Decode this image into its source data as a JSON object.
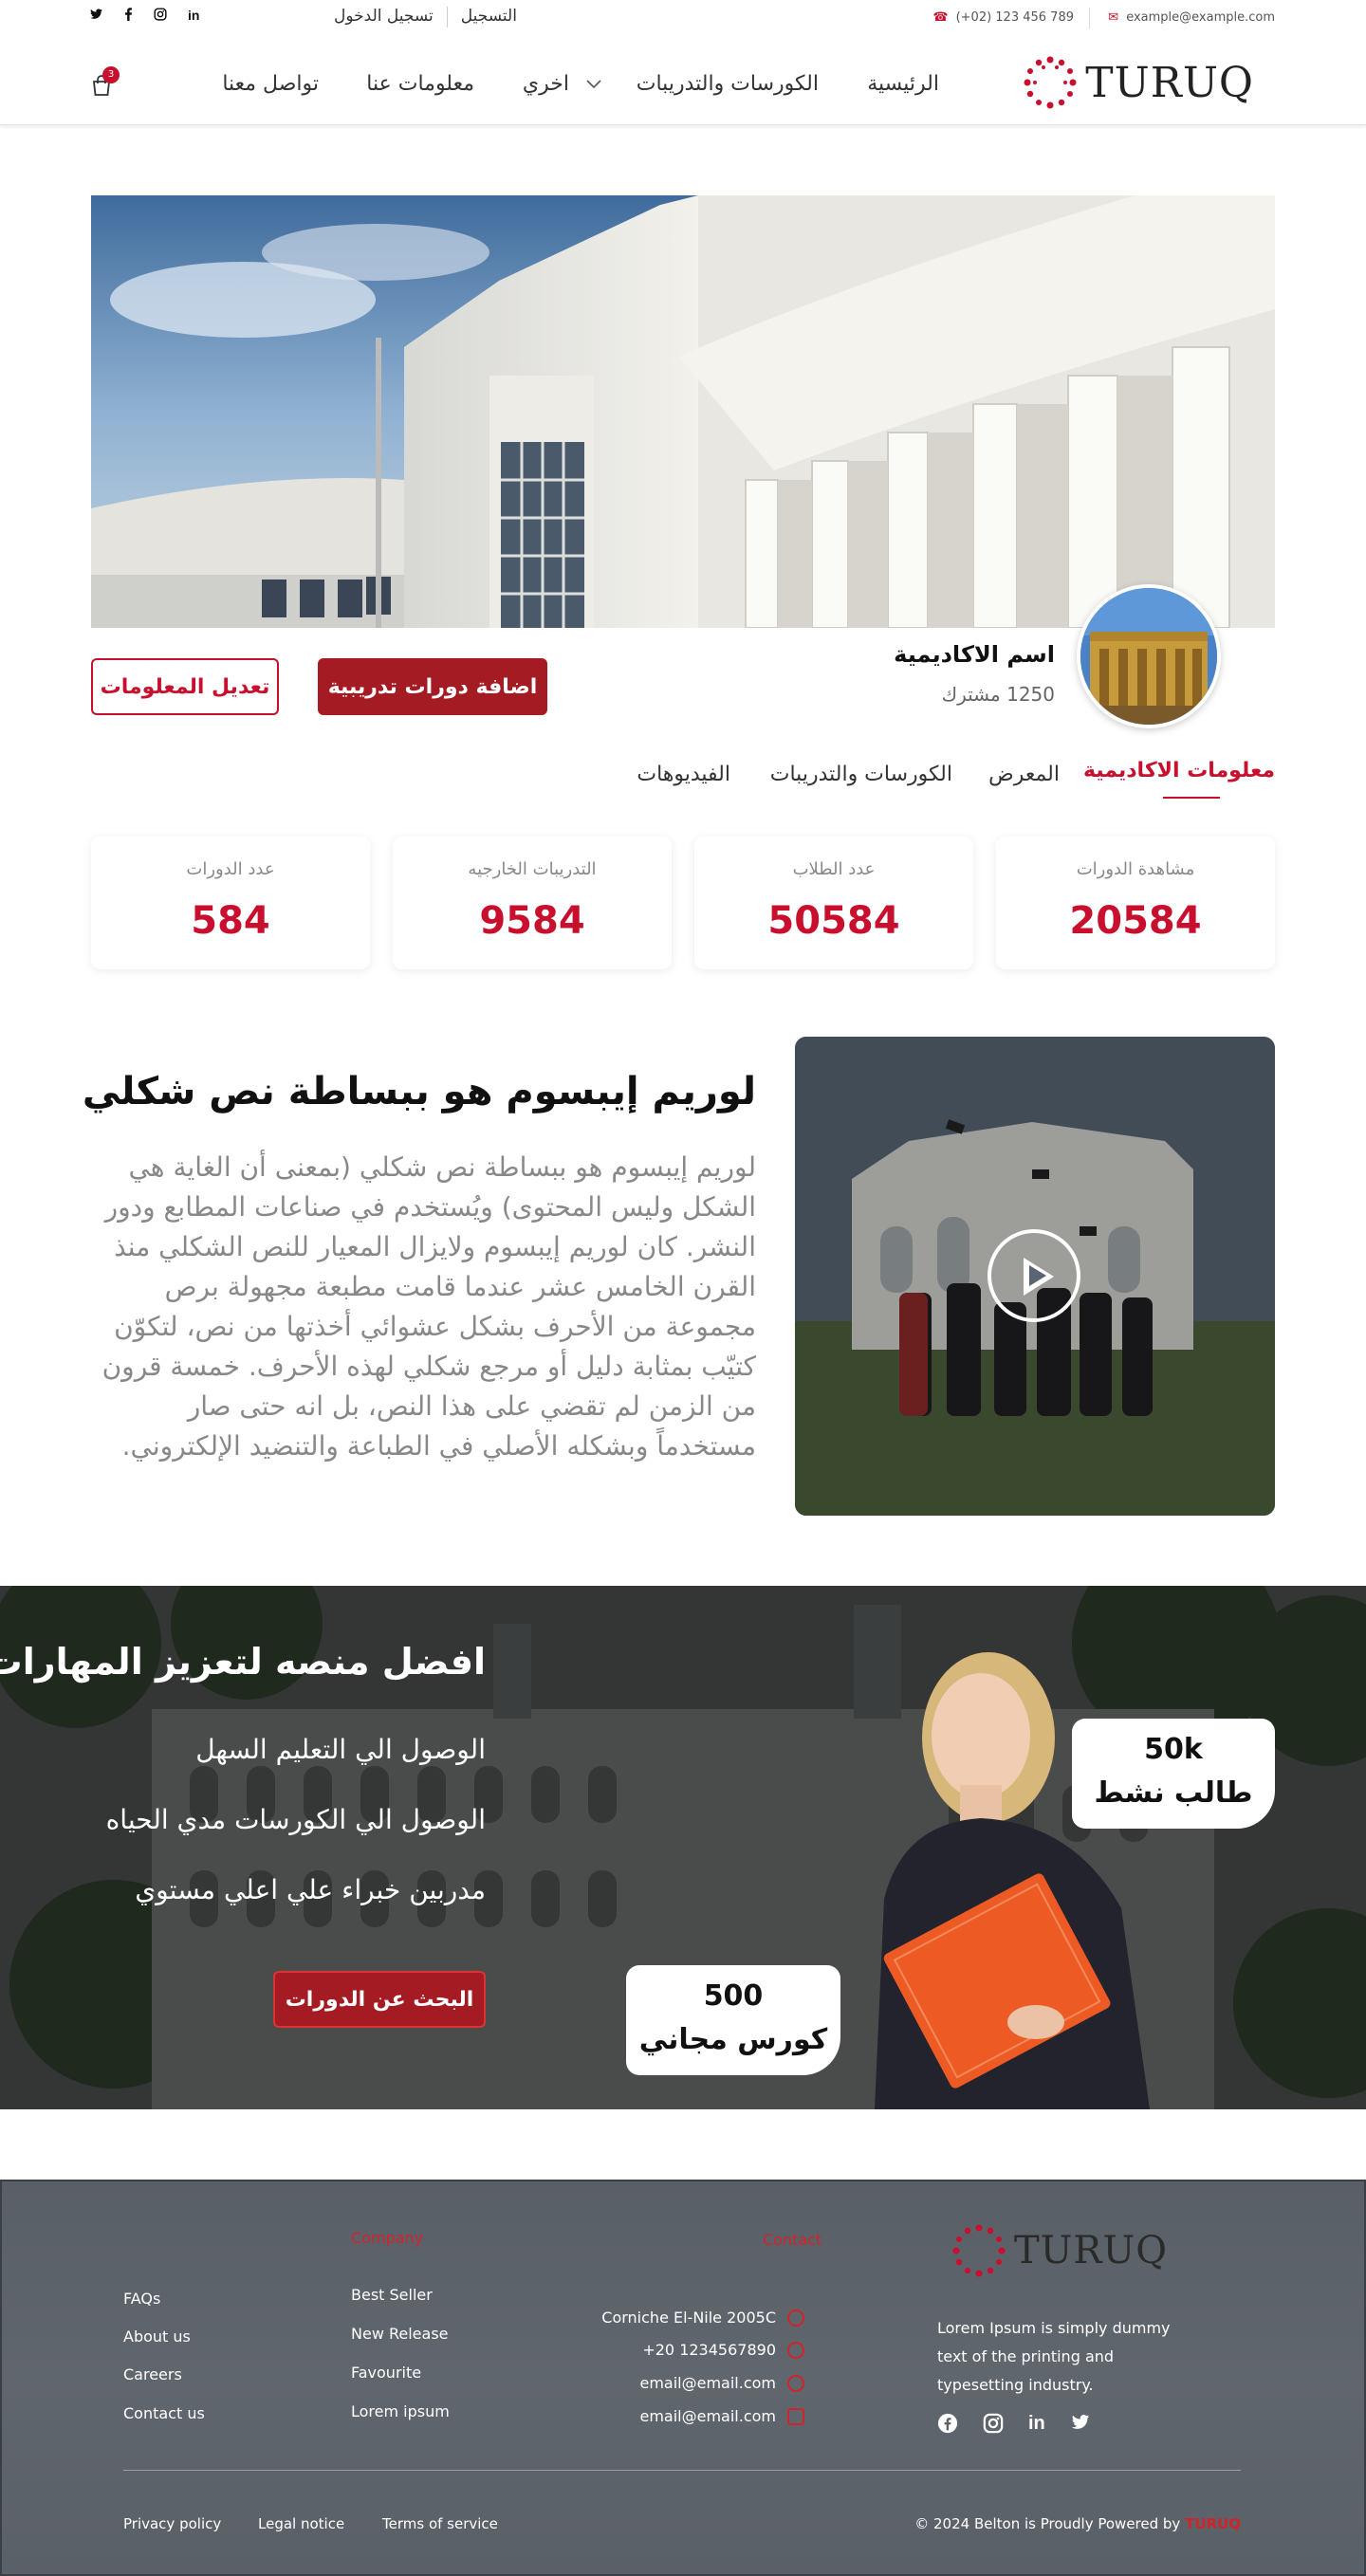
{
  "topbar": {
    "email": "example@example.com",
    "phone": "(+02) 123 456 789",
    "login": "تسجيل الدخول",
    "register": "التسجيل",
    "social_icons": [
      "twitter-icon",
      "facebook-icon",
      "instagram-icon",
      "linkedin-icon"
    ]
  },
  "nav": {
    "logo": "TURUQ",
    "items": [
      "الرئيسية",
      "الكورسات والتدريبات",
      "اخري",
      "معلومات عنا",
      "تواصل معنا"
    ],
    "cart_count": "3"
  },
  "academy": {
    "name": "اسم الاكاديمية",
    "subscribers": "1250 مشترك",
    "add_courses_btn": "اضافة دورات تدريبية",
    "edit_info_btn": "تعديل المعلومات"
  },
  "tabs": [
    "معلومات الاكاديمية",
    "المعرض",
    "الكورسات والتدريبات",
    "الفيديوهات"
  ],
  "stats": [
    {
      "label": "مشاهدة الدورات",
      "value": "20584"
    },
    {
      "label": "عدد الطلاب",
      "value": "50584"
    },
    {
      "label": "التدريبات الخارجيه",
      "value": "9584"
    },
    {
      "label": "عدد الدورات",
      "value": "584"
    }
  ],
  "about": {
    "title": "لوريم إيبسوم هو ببساطة نص شكلي",
    "text": "لوريم إيبسوم هو ببساطة نص شكلي (بمعنى أن الغاية هي الشكل وليس المحتوى) ويُستخدم في صناعات المطابع ودور النشر. كان لوريم إيبسوم ولايزال المعيار للنص الشكلي منذ القرن الخامس عشر عندما قامت مطبعة مجهولة برص مجموعة من الأحرف بشكل عشوائي أخذتها من نص، لتكوّن كتيّب بمثابة دليل أو مرجع شكلي لهذه الأحرف. خمسة قرون من الزمن لم تقضي على هذا النص، بل انه حتى صار مستخدماً وبشكله الأصلي في الطباعة والتنضيد الإلكتروني."
  },
  "promo": {
    "title": "افضل منصه لتعزيز المهارات",
    "items": [
      "الوصول الي التعليم السهل",
      "الوصول الي الكورسات مدي الحياه",
      "مدربين خبراء علي اعلي مستوي"
    ],
    "button": "البحث عن الدورات",
    "badge_students_num": "50k",
    "badge_students_label": "طالب نشط",
    "badge_courses_num": "500",
    "badge_courses_label": "كورس مجاني"
  },
  "footer": {
    "logo": "TURUQ",
    "description": "Lorem Ipsum is simply dummy text of the printing and typesetting industry.",
    "col_contact_head": "Contact",
    "contacts": [
      "Corniche El-Nile 2005C",
      "+20 1234567890",
      "email@email.com",
      "email@email.com"
    ],
    "col_company_head": "Company",
    "company_links": [
      "Best Seller",
      "New Release",
      "Favourite",
      "Lorem ipsum"
    ],
    "help_links": [
      "FAQs",
      "About us",
      "Careers",
      "Contact us"
    ],
    "bottom_links": [
      "Privacy policy",
      "Legal notice",
      "Terms of service"
    ],
    "copyright": "© 2024 Belton is Proudly Powered by",
    "powered_brand": "TURUQ"
  },
  "colors": {
    "accent": "#c8102e",
    "button_dark_red": "#a51b23"
  }
}
